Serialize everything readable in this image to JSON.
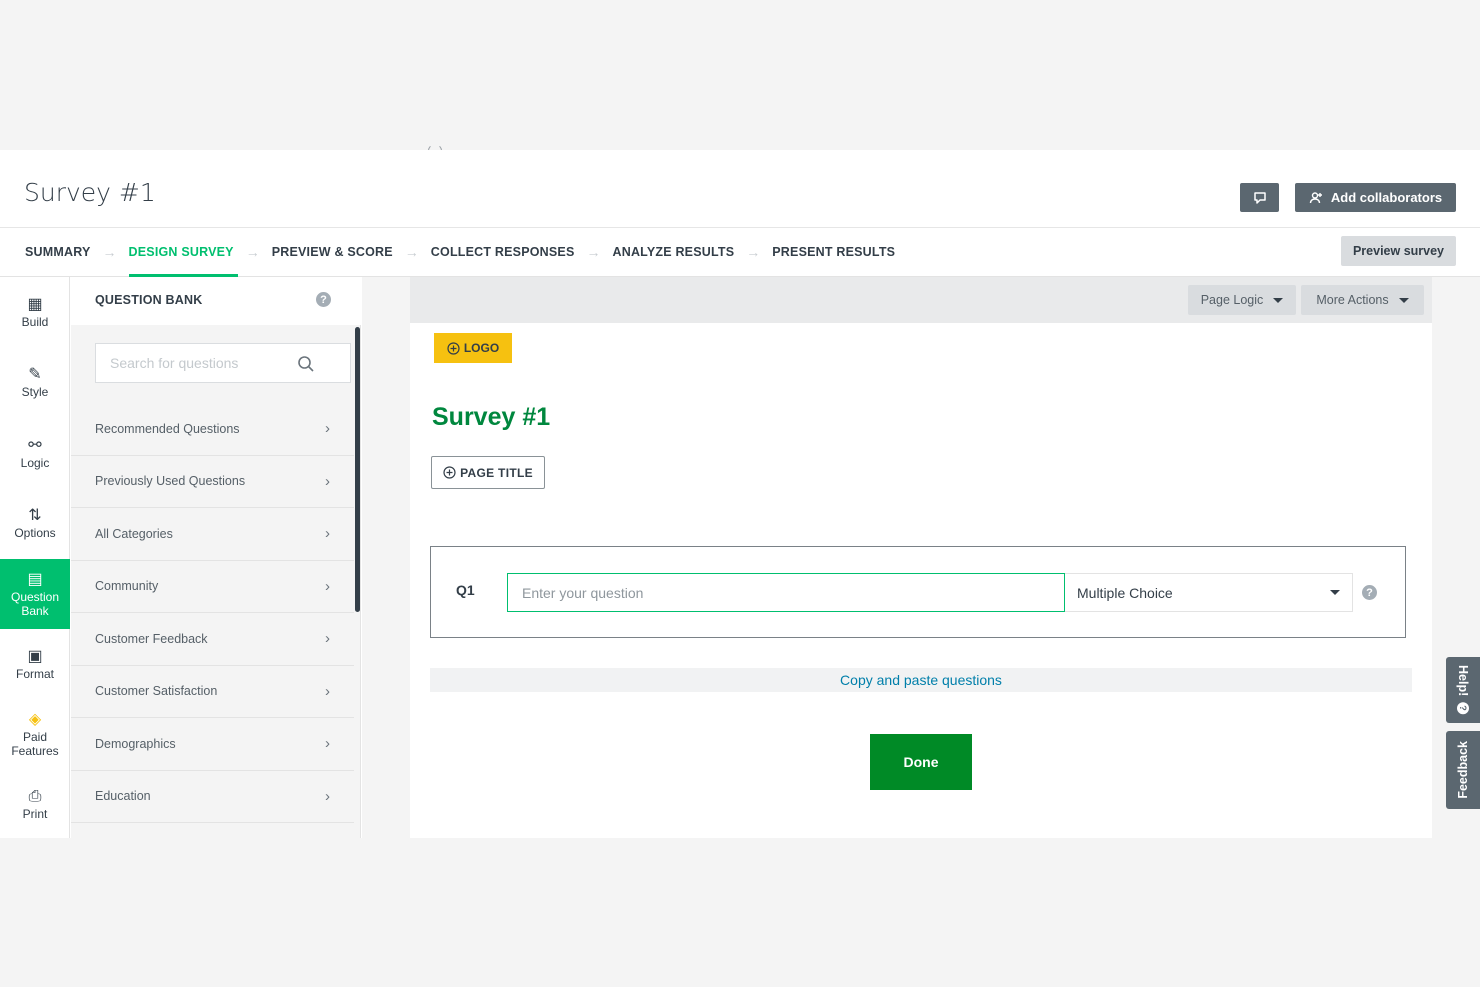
{
  "header": {
    "survey_title": "Survey #1",
    "add_collaborators": "Add collaborators"
  },
  "nav": {
    "tabs": [
      {
        "label": "SUMMARY",
        "active": false
      },
      {
        "label": "DESIGN SURVEY",
        "active": true
      },
      {
        "label": "PREVIEW & SCORE",
        "active": false
      },
      {
        "label": "COLLECT RESPONSES",
        "active": false
      },
      {
        "label": "ANALYZE RESULTS",
        "active": false
      },
      {
        "label": "PRESENT RESULTS",
        "active": false
      }
    ],
    "preview_survey": "Preview survey"
  },
  "rail": {
    "items": [
      {
        "label": "Build",
        "icon": "build-icon"
      },
      {
        "label": "Style",
        "icon": "brush-icon"
      },
      {
        "label": "Logic",
        "icon": "logic-icon"
      },
      {
        "label": "Options",
        "icon": "sliders-icon"
      },
      {
        "label": "Question Bank",
        "icon": "bank-icon",
        "active": true
      },
      {
        "label": "Format",
        "icon": "format-icon"
      },
      {
        "label": "Paid Features",
        "icon": "tag-icon"
      },
      {
        "label": "Print",
        "icon": "print-icon"
      }
    ]
  },
  "bank": {
    "title": "QUESTION BANK",
    "search_placeholder": "Search for questions",
    "items": [
      "Recommended Questions",
      "Previously Used Questions",
      "All Categories",
      "Community",
      "Customer Feedback",
      "Customer Satisfaction",
      "Demographics",
      "Education"
    ]
  },
  "toolbar": {
    "page_logic": "Page Logic",
    "more_actions": "More Actions"
  },
  "page": {
    "logo_label": "LOGO",
    "heading": "Survey #1",
    "page_title_label": "PAGE TITLE",
    "question": {
      "number": "Q1",
      "placeholder": "Enter your question",
      "type": "Multiple Choice"
    },
    "copy_paste": "Copy and paste questions",
    "done": "Done"
  },
  "side_tabs": {
    "help": "Help!",
    "feedback": "Feedback"
  },
  "colors": {
    "brand_green": "#00bf6f",
    "done_green": "#008a26",
    "logo_yellow": "#f6c110",
    "slate": "#5b6770",
    "link_blue": "#007faa"
  }
}
